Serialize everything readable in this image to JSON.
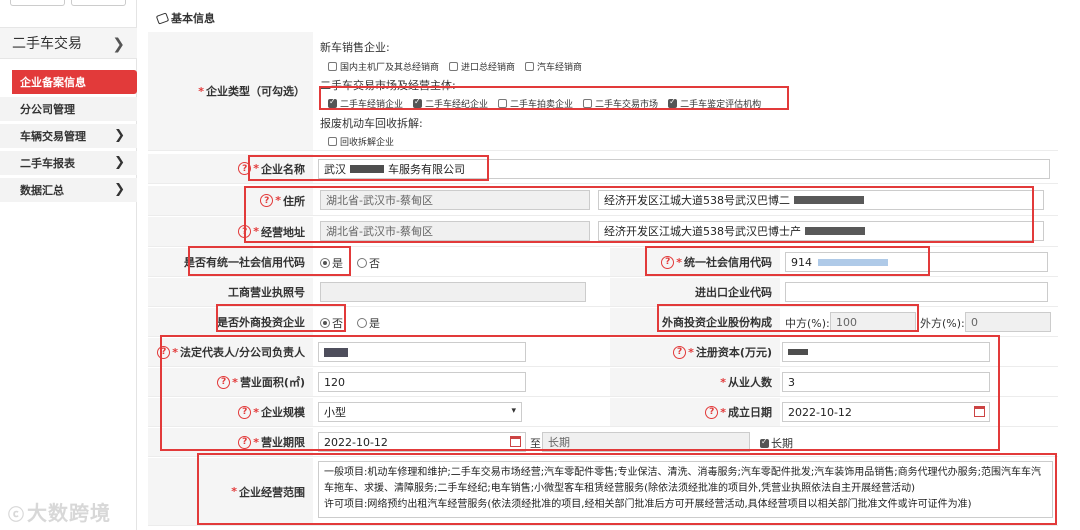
{
  "sidebar": {
    "section": "二手车交易",
    "items": [
      {
        "label": "企业备案信息",
        "active": true
      },
      {
        "label": "分公司管理"
      },
      {
        "label": "车辆交易管理",
        "chevron": true
      },
      {
        "label": "二手车报表",
        "chevron": true
      },
      {
        "label": "数据汇总",
        "chevron": true
      }
    ]
  },
  "watermark": "大数跨境",
  "section_title": "基本信息",
  "enterprise_type": {
    "label": "企业类型（可勾选）",
    "new_car_title": "新车销售企业:",
    "new_car_options": [
      {
        "label": "国内主机厂及其总经销商",
        "checked": false
      },
      {
        "label": "进口总经销商",
        "checked": false
      },
      {
        "label": "汽车经销商",
        "checked": false
      }
    ],
    "used_car_title": "二手车交易市场及经营主体:",
    "used_car_options": [
      {
        "label": "二手车经销企业",
        "checked": true
      },
      {
        "label": "二手车经纪企业",
        "checked": true
      },
      {
        "label": "二手车拍卖企业",
        "checked": false
      },
      {
        "label": "二手车交易市场",
        "checked": false
      },
      {
        "label": "二手车鉴定评估机构",
        "checked": true
      }
    ],
    "scrap_title": "报废机动车回收拆解:",
    "scrap_options": [
      {
        "label": "回收拆解企业",
        "checked": false
      }
    ]
  },
  "company_name": {
    "label": "企业名称",
    "value": "武汉",
    "value_tail": "车服务有限公司"
  },
  "residence": {
    "label": "住所",
    "region": "湖北省-武汉市-蔡甸区",
    "address": "经济开发区江城大道538号武汉巴博二"
  },
  "business_address": {
    "label": "经营地址",
    "region": "湖北省-武汉市-蔡甸区",
    "address": "经济开发区江城大道538号武汉巴博士产"
  },
  "has_credit_code": {
    "label": "是否有统一社会信用代码",
    "yes": "是",
    "no": "否",
    "selected": "是"
  },
  "credit_code": {
    "label": "统一社会信用代码",
    "value": "914"
  },
  "business_license": {
    "label": "工商营业执照号",
    "value": ""
  },
  "import_export": {
    "label": "进出口企业代码",
    "value": ""
  },
  "foreign_invest": {
    "label": "是否外商投资企业",
    "no": "否",
    "yes": "是",
    "selected": "否"
  },
  "share_structure": {
    "label": "外商投资企业股份构成",
    "cn_label": "中方(%):",
    "cn_value": "100",
    "foreign_label": "外方(%):",
    "foreign_value": "0"
  },
  "legal_rep": {
    "label": "法定代表人/分公司负责人",
    "value": ""
  },
  "registered_capital": {
    "label": "注册资本(万元)",
    "value": ""
  },
  "business_area": {
    "label": "营业面积(㎡)",
    "value": "120"
  },
  "employees": {
    "label": "从业人数",
    "value": "3"
  },
  "scale": {
    "label": "企业规模",
    "value": "小型"
  },
  "established": {
    "label": "成立日期",
    "value": "2022-10-12"
  },
  "business_term": {
    "label": "营业期限",
    "start": "2022-10-12",
    "to": "至",
    "end": "长期",
    "long_term_label": "长期",
    "long_term_checked": true
  },
  "business_scope": {
    "label": "企业经营范围",
    "text": "一般项目:机动车修理和维护;二手车交易市场经营;汽车零配件零售;专业保洁、清洗、消毒服务;汽车零配件批发;汽车装饰用品销售;商务代理代办服务;范围汽车车汽车拖车、求援、清障服务;二手车经纪;电车销售;小微型客车租赁经营服务(除依法须经批准的项目外,凭营业执照依法自主开展经营活动)\n许可项目:网络预约出租汽车经营服务(依法须经批准的项目,经相关部门批准后方可开展经营活动,具体经营项目以相关部门批准文件或许可证件为准)"
  },
  "colors": {
    "accent": "#e23a3a",
    "label_bg": "#f5f5f5"
  }
}
